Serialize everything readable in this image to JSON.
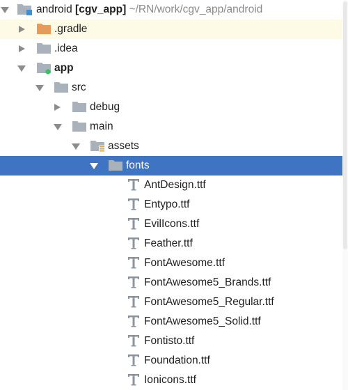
{
  "project": {
    "root_name": "android",
    "module": "[cgv_app]",
    "path": "~/RN/work/cgv_app/android"
  },
  "tree": {
    "gradle": ".gradle",
    "idea": ".idea",
    "app": "app",
    "src": "src",
    "debug": "debug",
    "main": "main",
    "assets": "assets",
    "fonts": "fonts",
    "files": [
      "AntDesign.ttf",
      "Entypo.ttf",
      "EvilIcons.ttf",
      "Feather.ttf",
      "FontAwesome.ttf",
      "FontAwesome5_Brands.ttf",
      "FontAwesome5_Regular.ttf",
      "FontAwesome5_Solid.ttf",
      "Fontisto.ttf",
      "Foundation.ttf",
      "Ionicons.ttf"
    ]
  },
  "colors": {
    "selection": "#3e74c1",
    "folder": "#a9b1bb",
    "gradle_folder": "#e79b5a",
    "module_dot": "#35c35f",
    "module_square": "#3d8fd1"
  }
}
